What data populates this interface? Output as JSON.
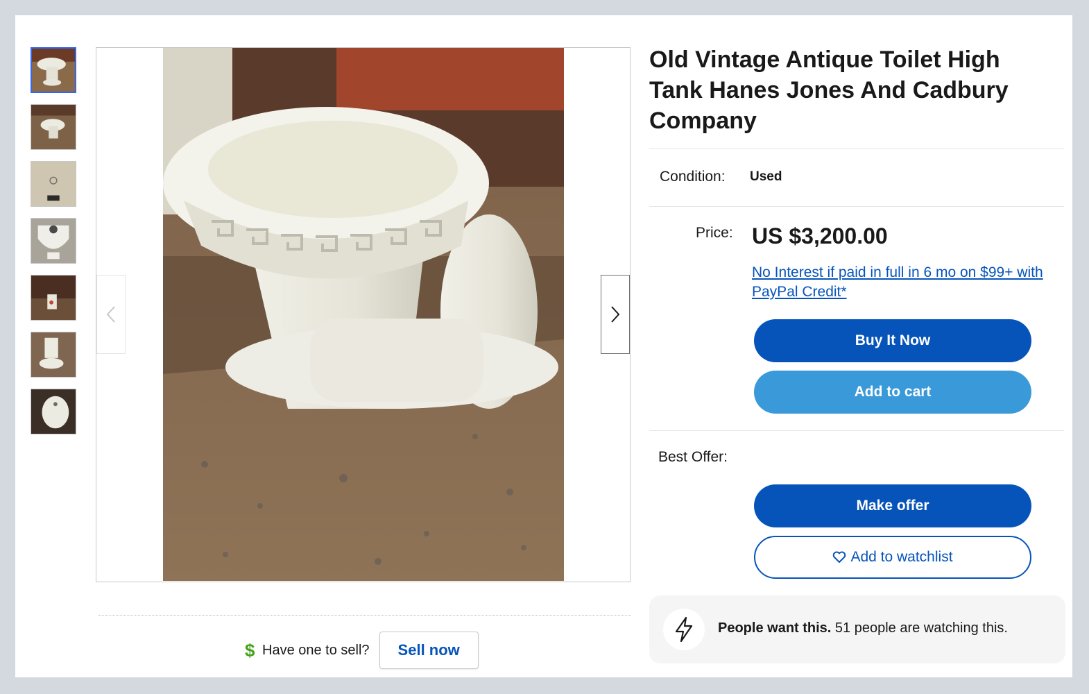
{
  "listing": {
    "title": "Old Vintage Antique Toilet High Tank Hanes Jones And Cadbury Company",
    "condition_label": "Condition:",
    "condition_value": "Used",
    "price_label": "Price:",
    "price_value": "US $3,200.00",
    "financing_link": "No Interest if paid in full in 6 mo on $99+ with PayPal Credit*",
    "buy_it_now_label": "Buy It Now",
    "add_to_cart_label": "Add to cart",
    "best_offer_label": "Best Offer:",
    "make_offer_label": "Make offer",
    "add_to_watchlist_label": "Add to watchlist"
  },
  "gallery": {
    "thumbnail_count": 7,
    "active_index": 0
  },
  "sell": {
    "question": "Have one to sell?",
    "button_label": "Sell now"
  },
  "signal": {
    "bold_text": "People want this.",
    "detail_text": "51 people are watching this."
  },
  "colors": {
    "primary_blue": "#0654ba",
    "secondary_blue": "#3a9ad9",
    "active_thumb_border": "#3665f3",
    "dollar_green": "#41a317"
  },
  "icons": {
    "prev": "chevron-left-icon",
    "next": "chevron-right-icon",
    "dollar": "dollar-icon",
    "heart": "heart-icon",
    "lightning": "lightning-icon"
  }
}
